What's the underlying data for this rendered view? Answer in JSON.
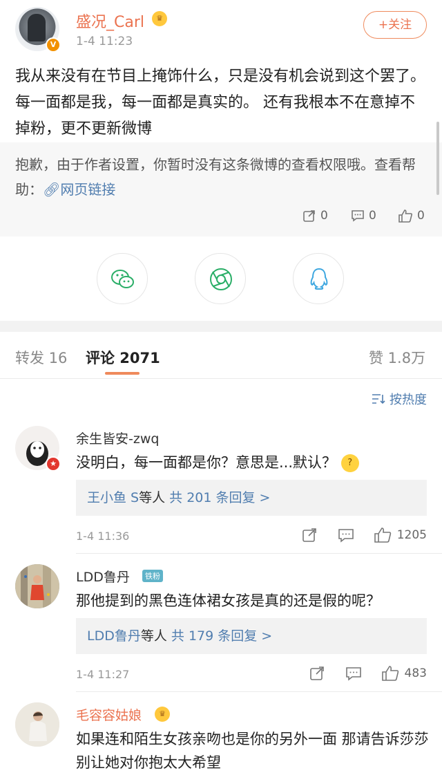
{
  "post": {
    "author": "盛况_Carl",
    "time": "1-4 11:23",
    "follow_label": "+关注",
    "text": "我从来没有在节目上掩饰什么，只是没有机会说到这个罢了。每一面都是我，每一面都是真实的。 还有我根本不在意掉不掉粉，更不更新微博",
    "notice": "抱歉，由于作者设置，你暂时没有这条微博的查看权限哦。查看帮助：",
    "notice_link": "网页链接",
    "stats": {
      "repost": "0",
      "comment": "0",
      "like": "0"
    },
    "verified_badge": "V"
  },
  "share": [
    {
      "name": "wechat-icon",
      "color": "#2aae67"
    },
    {
      "name": "moments-icon",
      "color": "#2aae67"
    },
    {
      "name": "qq-icon",
      "color": "#3ea7e0"
    }
  ],
  "tabs": {
    "repost": "转发 16",
    "comment": "评论 2071",
    "like": "赞 1.8万"
  },
  "sort_label": "按热度",
  "comments": [
    {
      "name": "余生皆安-zwq",
      "text": "没明白，每一面都是你？意思是...默认？",
      "reply_user": "王小鱼 S",
      "reply_suffix": "等人",
      "reply_count": "共 201 条回复 >",
      "time": "1-4 11:36",
      "likes": "1205"
    },
    {
      "name": "LDD鲁丹",
      "badge": "铁粉",
      "text": "那他提到的黑色连体裙女孩是真的还是假的呢？",
      "reply_user": "LDD鲁丹",
      "reply_suffix": "等人",
      "reply_count": "共 179 条回复 >",
      "time": "1-4 11:27",
      "likes": "483"
    },
    {
      "name": "毛容容姑娘",
      "text": "如果连和陌生女孩亲吻也是你的另外一面  那请告诉莎莎  别让她对你抱太大希望"
    }
  ]
}
